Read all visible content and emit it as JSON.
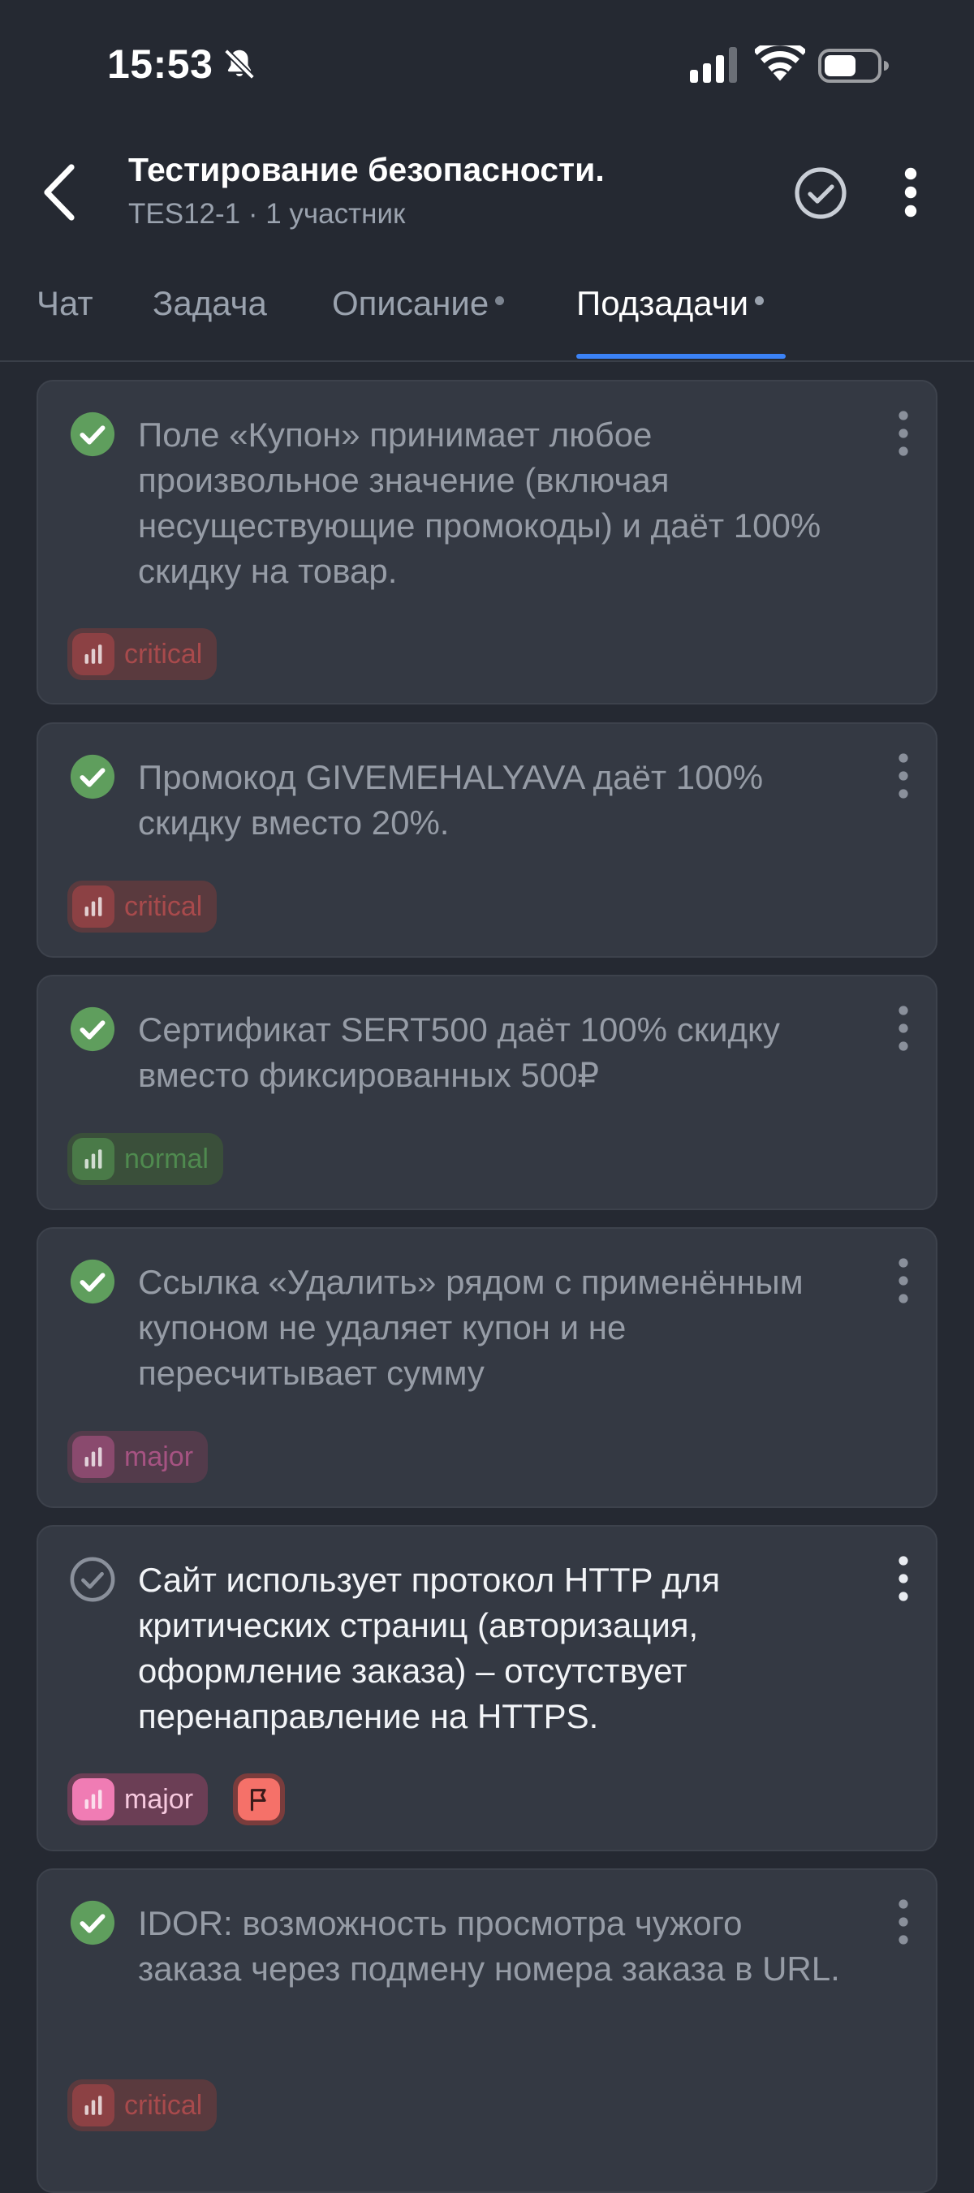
{
  "status_bar": {
    "time": "15:53"
  },
  "header": {
    "title": "Тестирование безопасности.",
    "subtitle": "TES12-1 · 1 участник"
  },
  "tabs": [
    {
      "label": "Чат",
      "active": false,
      "dot": false
    },
    {
      "label": "Задача",
      "active": false,
      "dot": false
    },
    {
      "label": "Описание",
      "active": false,
      "dot": true
    },
    {
      "label": "Подзадачи",
      "active": true,
      "dot": true
    }
  ],
  "subtasks": [
    {
      "text": "Поле «Купон» принимает любое произвольное значение (включая несуществующие промокоды) и даёт 100% скидку на товар.",
      "done": true,
      "priority": "critical",
      "flagged": false
    },
    {
      "text": "Промокод GIVEMEHALYAVA даёт 100% скидку вместо 20%.",
      "done": true,
      "priority": "critical",
      "flagged": false
    },
    {
      "text": "Сертификат SERT500 даёт 100% скидку вместо фиксированных 500₽",
      "done": true,
      "priority": "normal",
      "flagged": false
    },
    {
      "text": "Ссылка «Удалить» рядом с применённым купоном не удаляет купон и не пересчитывает сумму",
      "done": true,
      "priority": "major",
      "flagged": false
    },
    {
      "text": "Сайт использует протокол HTTP для критических страниц (авторизация, оформление заказа) – отсутствует перенаправление на HTTPS.",
      "done": false,
      "priority": "major",
      "flagged": true
    },
    {
      "text": "IDOR: возможность просмотра чужого заказа через подмену номера заказа в URL.",
      "done": true,
      "priority": "critical",
      "flagged": false
    }
  ],
  "colors": {
    "background": "#252932",
    "card": "#343943",
    "accent": "#3b82f6",
    "done_green": "#5f9e5d",
    "critical": "#8c4144",
    "normal": "#4a7a48",
    "major": "#f07cb4",
    "flag": "#f57169"
  }
}
